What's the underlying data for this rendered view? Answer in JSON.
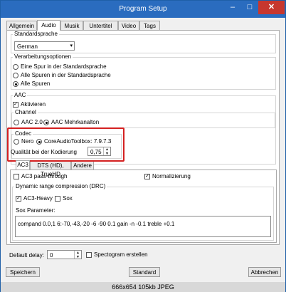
{
  "window": {
    "title": "Program Setup",
    "minimize": "–",
    "maximize": "□",
    "close": "✕"
  },
  "tabs": [
    "Allgemein",
    "Audio",
    "Musik",
    "Untertitel",
    "Video",
    "Tags"
  ],
  "standardsprache": {
    "label": "Standardsprache",
    "value": "German"
  },
  "verarbeitung": {
    "label": "Verarbeitungsoptionen",
    "options": [
      "Eine Spur in der Standardsprache",
      "Alle Spuren in der Standardsprache",
      "Alle Spuren"
    ]
  },
  "aac": {
    "label": "AAC",
    "aktivieren": "Aktivieren",
    "channel_label": "Channel",
    "channel_options": [
      "AAC 2.0",
      "AAC Mehrkanalton"
    ],
    "codec_label": "Codec",
    "codec_options": [
      "Nero",
      "CoreAudioToolbox: 7.9.7.3"
    ],
    "quality_label": "Qualität bei der Kodierung",
    "quality_value": "0,75"
  },
  "subtabs": [
    "AC3",
    "DTS (HD), TrueHD",
    "Andere"
  ],
  "ac3": {
    "passthrough": "AC3 pass-through",
    "normalisierung": "Normalizierung",
    "drc_label": "Dynamic range compression (DRC)",
    "ac3_heavy": "AC3-Heavy",
    "sox": "Sox",
    "sox_param_label": "Sox Parameter:",
    "sox_param_value": "compand 0.0,1 6:-70,-43,-20 -6 -90 0.1 gain -n -0.1 treble +0.1"
  },
  "bottom": {
    "delay_label": "Default delay:",
    "delay_value": "0",
    "spectogram": "Spectogram erstellen"
  },
  "buttons": {
    "save": "Speichern",
    "standard": "Standard",
    "cancel": "Abbrechen"
  },
  "footer": "666x654  105kb  JPEG",
  "colors": {
    "titlebar": "#2a6cbf",
    "close": "#c7372e",
    "highlight": "#d42020"
  }
}
